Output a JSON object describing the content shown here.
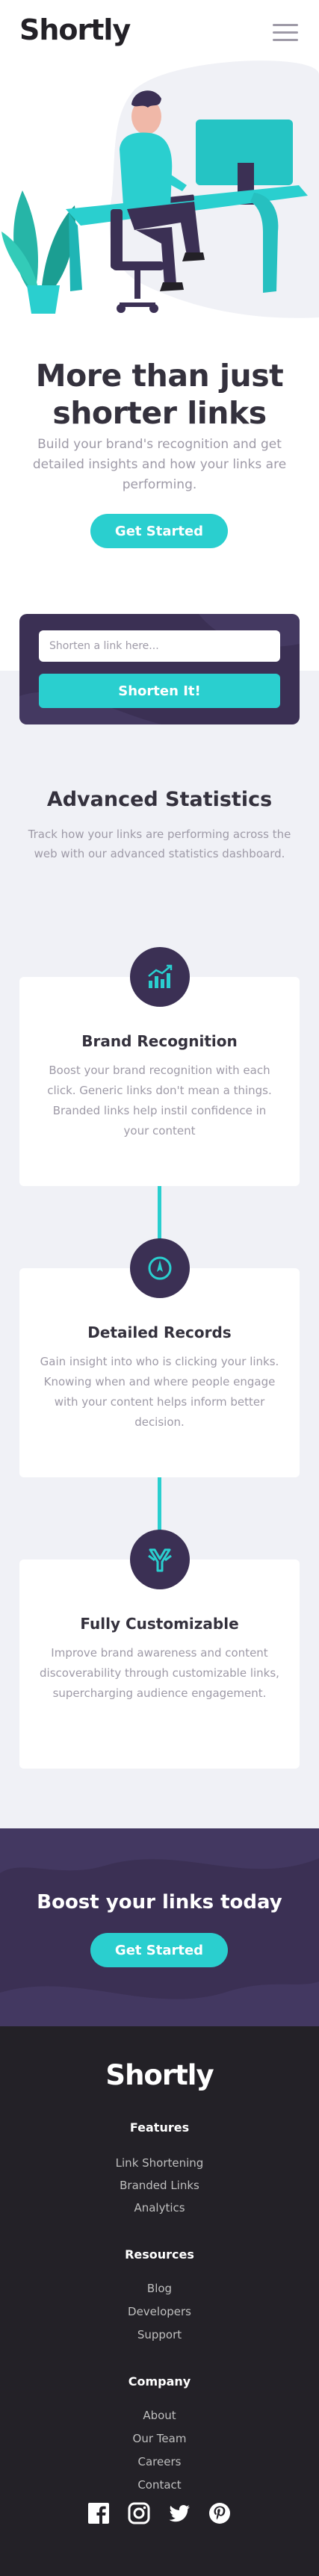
{
  "header": {
    "logo": "Shortly",
    "menu_icon": "hamburger-menu-icon"
  },
  "hero": {
    "title": "More than just shorter links",
    "subtitle": "Build your brand's recognition and get detailed insights and how your links are performing.",
    "cta": "Get Started",
    "illustration": "person-working-illustration"
  },
  "shorten": {
    "placeholder": "Shorten a link here...",
    "button": "Shorten It!"
  },
  "stats": {
    "title": "Advanced Statistics",
    "subtitle": "Track how your links are performing across the web with our advanced statistics dashboard.",
    "cards": [
      {
        "icon": "brand-recognition-icon",
        "title": "Brand Recognition",
        "text": "Boost your brand recognition with each click. Generic links don't mean a things. Branded links help instil confidence in your content"
      },
      {
        "icon": "detailed-records-icon",
        "title": "Detailed Records",
        "text": "Gain insight into who is clicking your links. Knowing when and where people engage with your content helps inform better decision."
      },
      {
        "icon": "fully-customizable-icon",
        "title": "Fully Customizable",
        "text": "Improve brand awareness and content discoverability through customizable links, supercharging audience engagement."
      }
    ]
  },
  "boost": {
    "title": "Boost your links today",
    "cta": "Get Started"
  },
  "footer": {
    "logo": "Shortly",
    "columns": [
      {
        "heading": "Features",
        "links": [
          "Link Shortening",
          "Branded Links",
          "Analytics"
        ]
      },
      {
        "heading": "Resources",
        "links": [
          "Blog",
          "Developers",
          "Support"
        ]
      },
      {
        "heading": "Company",
        "links": [
          "About",
          "Our Team",
          "Careers",
          "Contact"
        ]
      }
    ],
    "social": [
      "facebook-icon",
      "instagram-icon",
      "twitter-icon",
      "pinterest-icon"
    ]
  },
  "colors": {
    "cyan": "#2acfcf",
    "dark_violet": "#3b3054",
    "very_dark_violet": "#232127",
    "gray": "#9e9aa7",
    "light_bg": "#f0f1f6"
  }
}
